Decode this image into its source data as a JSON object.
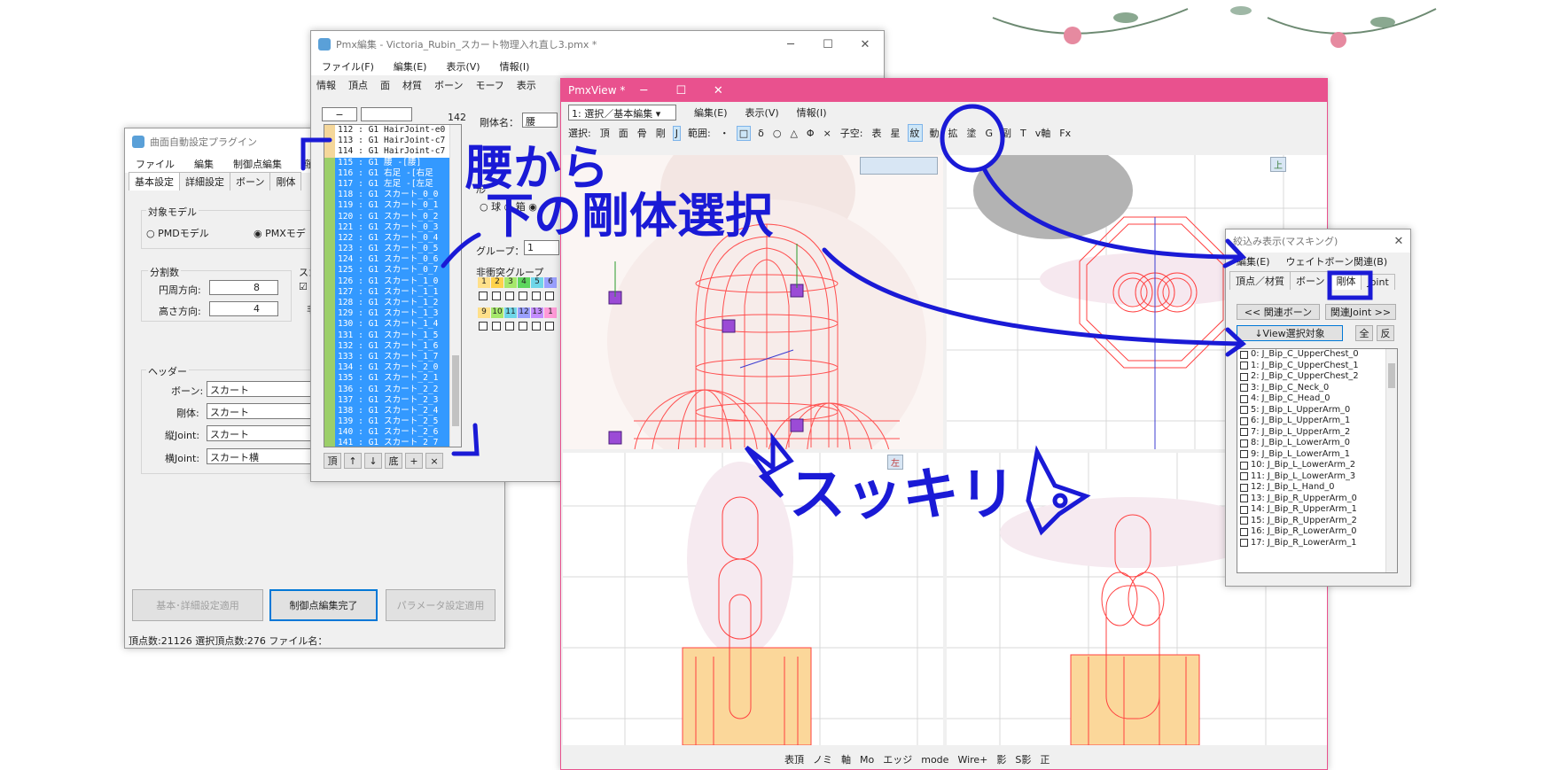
{
  "plugin_window": {
    "title": "曲面自動設定プラグイン",
    "menu": [
      "ファイル",
      "編集",
      "制御点編集",
      "簡"
    ],
    "tabs": [
      "基本設定",
      "詳細設定",
      "ボーン",
      "剛体"
    ],
    "target_model": {
      "label": "対象モデル",
      "option_pmd": "PMDモデル",
      "option_pmx": "PMXモデ",
      "selected": "PMX"
    },
    "division": {
      "label": "分割数",
      "circ_label": "円周方向:",
      "circ_value": "8",
      "height_label": "高さ方向:",
      "height_value": "4"
    },
    "side_label": "スカ",
    "side_label2": "非",
    "header": {
      "label": "ヘッダー",
      "bone_label": "ボーン:",
      "bone_value": "スカート",
      "body_label": "剛体:",
      "body_value": "スカート",
      "vjoint_label": "縦Joint:",
      "vjoint_value": "スカート",
      "hjoint_label": "横Joint:",
      "hjoint_value": "スカート横"
    },
    "buttons": {
      "apply_basic": "基本･詳細設定適用",
      "finish_edit": "制御点編集完了",
      "apply_param": "パラメータ設定適用"
    },
    "status": "頂点数:21126  選択頂点数:276  ファイル名："
  },
  "pmx_editor": {
    "title": "Pmx編集 - Victoria_Rubin_スカート物理入れ直し3.pmx *",
    "menu": [
      "ファイル(F)",
      "編集(E)",
      "表示(V)",
      "情報(I)"
    ],
    "tabs": [
      "情報",
      "頂点",
      "面",
      "材質",
      "ボーン",
      "モーフ",
      "表示"
    ],
    "count": "142",
    "search_dash": "−",
    "rows": [
      {
        "text": "112 : G1   HairJoint-e0",
        "state": "normal"
      },
      {
        "text": "113 : G1   HairJoint-c7",
        "state": "normal"
      },
      {
        "text": "114 : G1   HairJoint-c7",
        "state": "normal"
      },
      {
        "text": "115 : G1   腰  -[腰]",
        "state": "sel"
      },
      {
        "text": "116 : G1   右足  -[右足",
        "state": "sel"
      },
      {
        "text": "117 : G1   左足  -[左足",
        "state": "sel"
      },
      {
        "text": "118 : G1   スカート_0_0",
        "state": "sel"
      },
      {
        "text": "119 : G1   スカート_0_1",
        "state": "sel"
      },
      {
        "text": "120 : G1   スカート_0_2",
        "state": "sel"
      },
      {
        "text": "121 : G1   スカート_0_3",
        "state": "sel"
      },
      {
        "text": "122 : G1   スカート_0_4",
        "state": "sel"
      },
      {
        "text": "123 : G1   スカート_0_5",
        "state": "sel"
      },
      {
        "text": "124 : G1   スカート_0_6",
        "state": "sel"
      },
      {
        "text": "125 : G1   スカート_0_7",
        "state": "sel"
      },
      {
        "text": "126 : G1   スカート_1_0",
        "state": "sel"
      },
      {
        "text": "127 : G1   スカート_1_1",
        "state": "sel"
      },
      {
        "text": "128 : G1   スカート_1_2",
        "state": "sel"
      },
      {
        "text": "129 : G1   スカート_1_3",
        "state": "sel"
      },
      {
        "text": "130 : G1   スカート_1_4",
        "state": "sel"
      },
      {
        "text": "131 : G1   スカート_1_5",
        "state": "sel"
      },
      {
        "text": "132 : G1   スカート_1_6",
        "state": "sel"
      },
      {
        "text": "133 : G1   スカート_1_7",
        "state": "sel"
      },
      {
        "text": "134 : G1   スカート_2_0",
        "state": "sel"
      },
      {
        "text": "135 : G1   スカート_2_1",
        "state": "sel"
      },
      {
        "text": "136 : G1   スカート_2_2",
        "state": "sel"
      },
      {
        "text": "137 : G1   スカート_2_3",
        "state": "sel"
      },
      {
        "text": "138 : G1   スカート_2_4",
        "state": "sel"
      },
      {
        "text": "139 : G1   スカート_2_5",
        "state": "sel"
      },
      {
        "text": "140 : G1   スカート_2_6",
        "state": "sel"
      },
      {
        "text": "141 : G1   スカート_2_7",
        "state": "sel"
      }
    ],
    "list_buttons": [
      "頂",
      "↑",
      "↓",
      "底",
      "+",
      "×"
    ],
    "body_name_label": "剛体名：",
    "body_name_value": "腰",
    "shape_label": "形",
    "shape_sphere": "球",
    "shape_box": "箱",
    "group_label": "グループ：",
    "group_value": "1",
    "nocollide_label": "非衝突グループ",
    "group_numbers": [
      "1",
      "2",
      "3",
      "4",
      "5",
      "6",
      "9",
      "10",
      "11",
      "12",
      "13",
      "1"
    ]
  },
  "pmx_view": {
    "title": "PmxView *",
    "mode_select": "1: 選択／基本編集",
    "menu": [
      "編集(E)",
      "表示(V)",
      "情報(I)"
    ],
    "toolbar": [
      "選択:",
      "頂",
      "面",
      "骨",
      "剛",
      "J",
      "範囲:",
      "・",
      "□",
      "δ",
      "○",
      "△",
      "Φ",
      "×",
      "子空:",
      "表",
      "星",
      "紋",
      "動",
      "拡",
      "塗",
      "G",
      "副",
      "T",
      "v軸",
      "Fx"
    ],
    "view_label_top": "上",
    "view_label_left": "左",
    "bottom_toolbar": [
      "表頂",
      "ノミ",
      "軸",
      "Mo",
      "エッジ",
      "mode",
      "Wire+",
      "影",
      "S影",
      "正"
    ]
  },
  "mask_panel": {
    "title": "絞込み表示(マスキング)",
    "menu": [
      "編集(E)",
      "ウェイトボーン関連(B)"
    ],
    "tabs": [
      "頂点／材質",
      "ボーン",
      "剛体",
      "Joint"
    ],
    "buttons": {
      "related_bone": "<< 関連ボーン",
      "related_joint": "関連Joint >>",
      "view_select": "↓View選択対象",
      "all": "全",
      "invert": "反"
    },
    "items": [
      "0:  J_Bip_C_UpperChest_0",
      "1:  J_Bip_C_UpperChest_1",
      "2:  J_Bip_C_UpperChest_2",
      "3:  J_Bip_C_Neck_0",
      "4:  J_Bip_C_Head_0",
      "5:  J_Bip_L_UpperArm_0",
      "6:  J_Bip_L_UpperArm_1",
      "7:  J_Bip_L_UpperArm_2",
      "8:  J_Bip_L_LowerArm_0",
      "9:  J_Bip_L_LowerArm_1",
      "10:  J_Bip_L_LowerArm_2",
      "11:  J_Bip_L_LowerArm_3",
      "12:  J_Bip_L_Hand_0",
      "13:  J_Bip_R_UpperArm_0",
      "14:  J_Bip_R_UpperArm_1",
      "15:  J_Bip_R_UpperArm_2",
      "16:  J_Bip_R_LowerArm_0",
      "17:  J_Bip_R_LowerArm_1"
    ]
  },
  "annotations": {
    "line1": "腰から",
    "line2": "下の剛体選択",
    "refreshed": "スッキリ"
  },
  "colors": {
    "ink": "#1a1ad6",
    "pmxview_title": "#e9518e",
    "selection": "#3399ff",
    "rigid_body": "#ff4040",
    "body_fill": "#fbd79a"
  }
}
